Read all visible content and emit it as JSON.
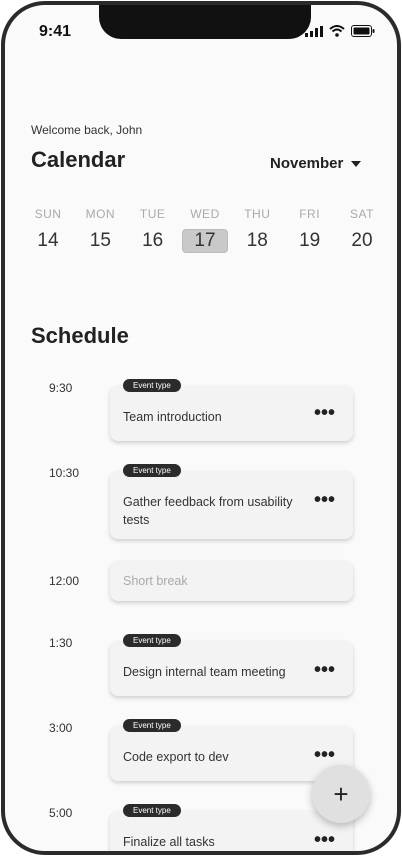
{
  "status_bar": {
    "time": "9:41"
  },
  "header": {
    "welcome": "Welcome back, John",
    "title": "Calendar",
    "month": "November"
  },
  "week": [
    {
      "dow": "SUN",
      "date": "14",
      "selected": false
    },
    {
      "dow": "MON",
      "date": "15",
      "selected": false
    },
    {
      "dow": "TUE",
      "date": "16",
      "selected": false
    },
    {
      "dow": "WED",
      "date": "17",
      "selected": true
    },
    {
      "dow": "THU",
      "date": "18",
      "selected": false
    },
    {
      "dow": "FRI",
      "date": "19",
      "selected": false
    },
    {
      "dow": "SAT",
      "date": "20",
      "selected": false
    }
  ],
  "schedule": {
    "title": "Schedule",
    "items": [
      {
        "time": "9:30",
        "badge": "Event type",
        "label": "Team introduction"
      },
      {
        "time": "10:30",
        "badge": "Event type",
        "label": "Gather feedback from usability tests"
      },
      {
        "time": "12:00",
        "label": "Short break"
      },
      {
        "time": "1:30",
        "badge": "Event type",
        "label": "Design internal team meeting"
      },
      {
        "time": "3:00",
        "badge": "Event type",
        "label": "Code export to dev"
      },
      {
        "time": "5:00",
        "badge": "Event type",
        "label": "Finalize all tasks"
      }
    ]
  },
  "fab": {
    "label": "+"
  }
}
